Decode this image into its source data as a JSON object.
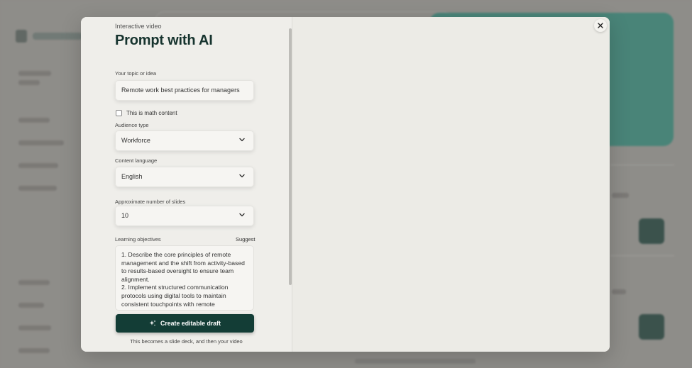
{
  "modal": {
    "eyebrow": "Interactive video",
    "title": "Prompt with AI"
  },
  "form": {
    "topic_label": "Your topic or idea",
    "topic_value": "Remote work best practices for managers",
    "math_label": "This is math content",
    "math_checked": false,
    "audience_label": "Audience type",
    "audience_value": "Workforce",
    "language_label": "Content language",
    "language_value": "English",
    "slides_label": "Approximate number of slides",
    "slides_value": "10",
    "objectives_label": "Learning objectives",
    "suggest_label": "Suggest",
    "objectives_value": "1. Describe the core principles of remote management and the shift from activity-based to results-based oversight to ensure team alignment.\n2. Implement structured communication protocols using digital tools to maintain consistent touchpoints with remote"
  },
  "cta": {
    "label": "Create editable draft",
    "icon": "sparkle-icon",
    "footnote": "This becomes a slide deck, and then your video"
  },
  "icons": {
    "close": "close-icon",
    "dropdown": "chevron-down-icon"
  },
  "colors": {
    "primary": "#133d36",
    "title": "#16332e",
    "background_teal": "#3d8376"
  }
}
